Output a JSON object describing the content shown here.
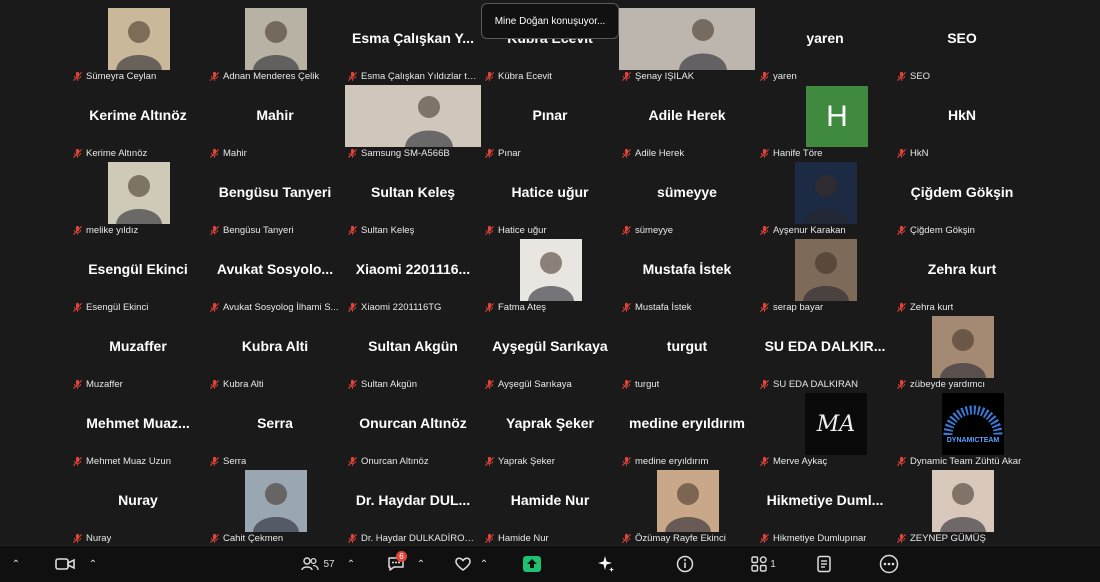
{
  "tooltip": "Mine Doğan konuşuyor...",
  "participants": [
    {
      "big": "",
      "cap": "Sümeyra Ceylan",
      "type": "photo",
      "color": "#c9b99a"
    },
    {
      "big": "",
      "cap": "Adnan Menderes Çelik",
      "type": "photo",
      "color": "#b8b2a4"
    },
    {
      "big": "Esma Çalışkan Y...",
      "cap": "Esma Çalışkan Yıldızlar ta...",
      "type": "name"
    },
    {
      "big": "Kübra Ecevit",
      "cap": "Kübra Ecevit",
      "type": "name"
    },
    {
      "big": "",
      "cap": "Şenay IŞILAK",
      "type": "photo-wide",
      "color": "#bdb6ae"
    },
    {
      "big": "yaren",
      "cap": "yaren",
      "type": "name"
    },
    {
      "big": "SEO",
      "cap": "SEO",
      "type": "name"
    },
    {
      "big": "Kerime Altınöz",
      "cap": "Kerime Altınöz",
      "type": "name"
    },
    {
      "big": "Mahir",
      "cap": "Mahir",
      "type": "name"
    },
    {
      "big": "",
      "cap": "Samsung SM-A566B",
      "type": "photo-wide",
      "color": "#cfc7bb"
    },
    {
      "big": "Pınar",
      "cap": "Pınar",
      "type": "name"
    },
    {
      "big": "Adile Herek",
      "cap": "Adile Herek",
      "type": "name"
    },
    {
      "big": "",
      "cap": "Hanife Töre",
      "type": "letter",
      "letter": "H"
    },
    {
      "big": "HkN",
      "cap": "HkN",
      "type": "name"
    },
    {
      "big": "",
      "cap": "melike yıldız",
      "type": "photo",
      "color": "#cfcab8"
    },
    {
      "big": "Bengüsu Tanyeri",
      "cap": "Bengüsu Tanyeri",
      "type": "name"
    },
    {
      "big": "Sultan Keleş",
      "cap": "Sultan Keleş",
      "type": "name"
    },
    {
      "big": "Hatice uğur",
      "cap": "Hatice uğur",
      "type": "name"
    },
    {
      "big": "sümeyye",
      "cap": "sümeyye",
      "type": "name"
    },
    {
      "big": "",
      "cap": "Ayşenur Karakan",
      "type": "photo",
      "color": "#1d2a44"
    },
    {
      "big": "Çiğdem Gökşin",
      "cap": "Çiğdem Gökşin",
      "type": "name"
    },
    {
      "big": "Esengül Ekinci",
      "cap": "Esengül Ekinci",
      "type": "name"
    },
    {
      "big": "Avukat Sosyolo...",
      "cap": "Avukat Sosyolog İlhami S...",
      "type": "name"
    },
    {
      "big": "Xiaomi 2201116...",
      "cap": "Xiaomi 2201116TG",
      "type": "name"
    },
    {
      "big": "",
      "cap": "Fatma Ateş",
      "type": "photo",
      "color": "#e9e6e1"
    },
    {
      "big": "Mustafa İstek",
      "cap": "Mustafa İstek",
      "type": "name"
    },
    {
      "big": "",
      "cap": "serap bayar",
      "type": "photo",
      "color": "#7d6a58"
    },
    {
      "big": "Zehra kurt",
      "cap": "Zehra kurt",
      "type": "name"
    },
    {
      "big": "Muzaffer",
      "cap": "Muzaffer",
      "type": "name"
    },
    {
      "big": "Kubra Alti",
      "cap": "Kubra Alti",
      "type": "name"
    },
    {
      "big": "Sultan Akgün",
      "cap": "Sultan Akgün",
      "type": "name"
    },
    {
      "big": "Ayşegül Sarıkaya",
      "cap": "Ayşegül Sarıkaya",
      "type": "name"
    },
    {
      "big": "turgut",
      "cap": "turgut",
      "type": "name"
    },
    {
      "big": "SU EDA DALKIR...",
      "cap": "SU EDA DALKIRAN",
      "type": "name"
    },
    {
      "big": "",
      "cap": "zübeyde yardımcı",
      "type": "photo",
      "color": "#a58a73"
    },
    {
      "big": "Mehmet Muaz...",
      "cap": "Mehmet Muaz Uzun",
      "type": "name"
    },
    {
      "big": "Serra",
      "cap": "Serra",
      "type": "name"
    },
    {
      "big": "Onurcan Altınöz",
      "cap": "Onurcan Altınöz",
      "type": "name"
    },
    {
      "big": "Yaprak Şeker",
      "cap": "Yaprak Şeker",
      "type": "name"
    },
    {
      "big": "medine eryıldırım",
      "cap": "medine eryıldırım",
      "type": "name"
    },
    {
      "big": "",
      "cap": "Merve Aykaç",
      "type": "logo-ma",
      "logo": "MA"
    },
    {
      "big": "",
      "cap": "Dynamic Team Zühtü Akar",
      "type": "logo-dt",
      "logo": "DYNAMICTEAM"
    },
    {
      "big": "Nuray",
      "cap": "Nuray",
      "type": "name"
    },
    {
      "big": "",
      "cap": "Cahit Çekmen",
      "type": "photo",
      "color": "#9aa7b3"
    },
    {
      "big": "Dr. Haydar DUL...",
      "cap": "Dr. Haydar DULKADİROĞ...",
      "type": "name"
    },
    {
      "big": "Hamide Nur",
      "cap": "Hamide Nur",
      "type": "name"
    },
    {
      "big": "",
      "cap": "Özümay Rayfe Ekinci",
      "type": "photo",
      "color": "#c9a88a"
    },
    {
      "big": "Hikmetiye Duml...",
      "cap": "Hikmetiye Dumlupınar",
      "type": "name"
    },
    {
      "big": "",
      "cap": "ZEYNEP GÜMÜŞ",
      "type": "photo",
      "color": "#d8c8bc"
    }
  ],
  "toolbar": {
    "participant_count": "57",
    "chat_badge": "6",
    "apps_count": "1"
  },
  "colors": {
    "background": "#1a1a1a",
    "mute": "#e0433a",
    "share": "#1fc171"
  }
}
